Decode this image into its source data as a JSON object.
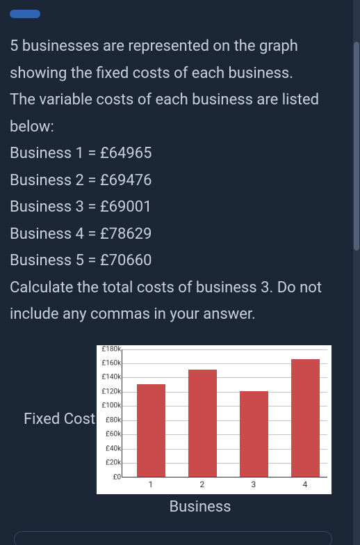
{
  "prose": {
    "intro1": "5 businesses are represented on the graph showing the fixed costs of each business.",
    "intro2": "The variable costs of each business are listed below:",
    "lines": [
      "Business 1 = £64965",
      "Business 2 = £69476",
      "Business 3 = £69001",
      "Business 4 = £78629",
      "Business 5 = £70660"
    ],
    "question": "Calculate the total costs of business 3. Do not include any commas in your answer."
  },
  "chart_data": {
    "type": "bar",
    "title": "",
    "xlabel": "Business",
    "ylabel": "Fixed Cost",
    "ylim": [
      0,
      180000
    ],
    "ytick_labels": [
      "£0",
      "£20k",
      "£40k",
      "£60k",
      "£80k",
      "£100k",
      "£120k",
      "£140k",
      "£160k",
      "£180k"
    ],
    "categories": [
      "1",
      "2",
      "3",
      "4"
    ],
    "values": [
      130000,
      150000,
      120000,
      165000
    ]
  }
}
